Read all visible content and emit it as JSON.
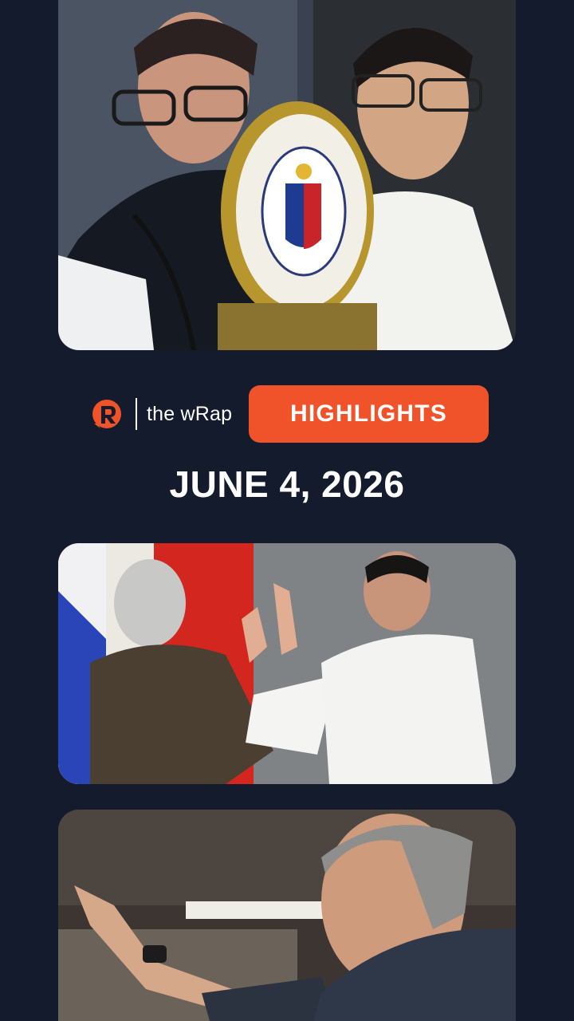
{
  "brand": {
    "logo_icon": "rappler-r-logo-icon",
    "name": "the wRap",
    "accent": "#f0532a"
  },
  "badge": {
    "label": "HIGHLIGHTS",
    "color": "#f0532a"
  },
  "date": "JUNE 4, 2026",
  "photos": [
    {
      "subject": "senate-session-photo"
    },
    {
      "subject": "oath-taking-photo"
    },
    {
      "subject": "speaker-photo"
    }
  ],
  "colors": {
    "background": "#141b2d",
    "text": "#ffffff"
  }
}
